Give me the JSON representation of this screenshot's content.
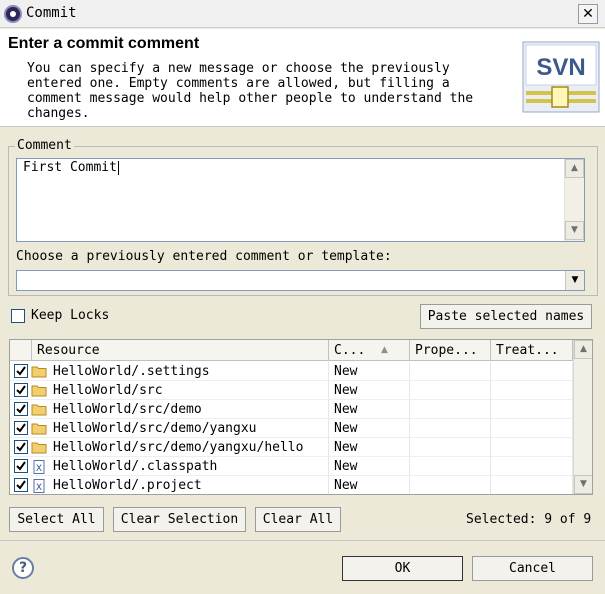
{
  "window": {
    "title": "Commit",
    "close_glyph": "✕"
  },
  "header": {
    "title": "Enter a commit comment",
    "description": "You can specify a new message or choose the previously entered one. Empty comments are allowed, but filling a comment message would help other people to understand the changes.",
    "logo_text": "SVN"
  },
  "comment": {
    "legend": "Comment",
    "value": "First Commit",
    "template_label": "Choose a previously entered comment or template:",
    "template_value": ""
  },
  "keep_locks": {
    "label": "Keep Locks",
    "checked": false
  },
  "paste_button": "Paste selected names",
  "table": {
    "columns": [
      "Resource",
      "C...",
      "Prope...",
      "Treat..."
    ],
    "rows": [
      {
        "checked": true,
        "icon": "folder-icon",
        "resource": "HelloWorld/.settings",
        "change": "New"
      },
      {
        "checked": true,
        "icon": "folder-icon",
        "resource": "HelloWorld/src",
        "change": "New"
      },
      {
        "checked": true,
        "icon": "folder-icon",
        "resource": "HelloWorld/src/demo",
        "change": "New"
      },
      {
        "checked": true,
        "icon": "folder-icon",
        "resource": "HelloWorld/src/demo/yangxu",
        "change": "New"
      },
      {
        "checked": true,
        "icon": "folder-icon",
        "resource": "HelloWorld/src/demo/yangxu/hello",
        "change": "New"
      },
      {
        "checked": true,
        "icon": "xml-file-icon",
        "resource": "HelloWorld/.classpath",
        "change": "New"
      },
      {
        "checked": true,
        "icon": "xml-file-icon",
        "resource": "HelloWorld/.project",
        "change": "New"
      }
    ]
  },
  "buttons": {
    "select_all": "Select All",
    "clear_selection": "Clear Selection",
    "clear_all": "Clear All",
    "ok": "OK",
    "cancel": "Cancel"
  },
  "selected_text": "Selected: 9 of 9",
  "colors": {
    "dialog_bg": "#ece9d8",
    "header_bg": "#ffffff",
    "folder": "#e8b64a",
    "check": "#1c5180"
  }
}
